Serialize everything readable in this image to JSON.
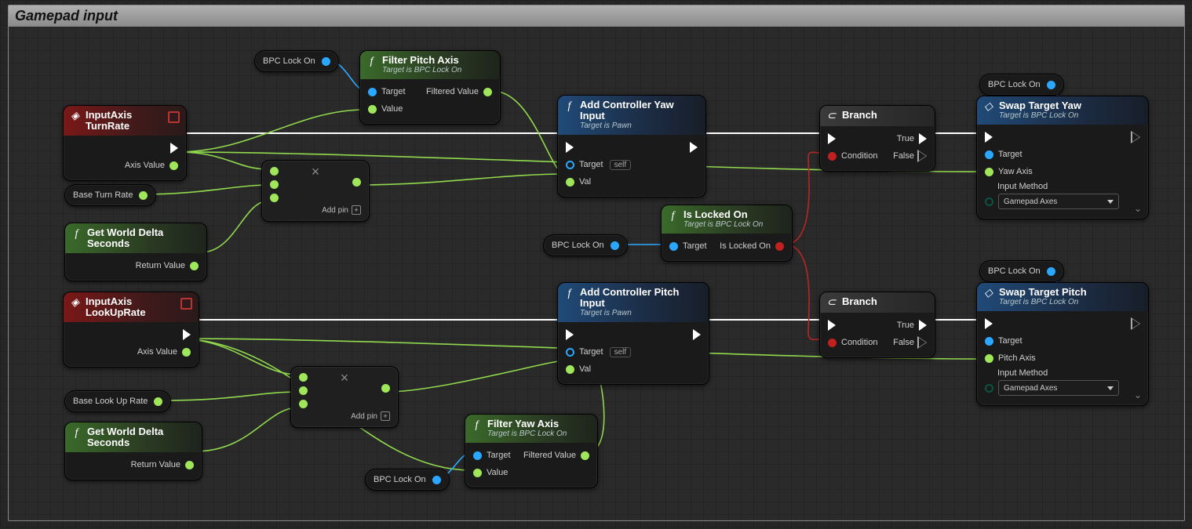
{
  "comment": {
    "title": "Gamepad input"
  },
  "vars": {
    "bpc_lock_on": "BPC Lock On",
    "base_turn_rate": "Base Turn Rate",
    "base_look_up_rate": "Base Look Up Rate"
  },
  "nodes": {
    "turn_rate": {
      "title": "InputAxis TurnRate",
      "axis_value": "Axis Value"
    },
    "lookup_rate": {
      "title": "InputAxis LookUpRate",
      "axis_value": "Axis Value"
    },
    "get_delta": {
      "title": "Get World Delta Seconds",
      "return": "Return Value"
    },
    "mult": {
      "add_pin": "Add pin"
    },
    "filter_pitch": {
      "title": "Filter Pitch Axis",
      "sub": "Target is BPC Lock On",
      "target": "Target",
      "value": "Value",
      "filtered": "Filtered Value"
    },
    "filter_yaw": {
      "title": "Filter Yaw Axis",
      "sub": "Target is BPC Lock On",
      "target": "Target",
      "value": "Value",
      "filtered": "Filtered Value"
    },
    "add_yaw": {
      "title": "Add Controller Yaw Input",
      "sub": "Target is Pawn",
      "target": "Target",
      "self": "self",
      "val": "Val"
    },
    "add_pitch": {
      "title": "Add Controller Pitch Input",
      "sub": "Target is Pawn",
      "target": "Target",
      "self": "self",
      "val": "Val"
    },
    "is_locked": {
      "title": "Is Locked On",
      "sub": "Target is BPC Lock On",
      "target": "Target",
      "out": "Is Locked On"
    },
    "branch": {
      "title": "Branch",
      "cond": "Condition",
      "t": "True",
      "f": "False"
    },
    "swap_yaw": {
      "title": "Swap Target Yaw",
      "sub": "Target is BPC Lock On",
      "target": "Target",
      "axis": "Yaw Axis",
      "method_lbl": "Input Method",
      "method_val": "Gamepad Axes"
    },
    "swap_pitch": {
      "title": "Swap Target Pitch",
      "sub": "Target is BPC Lock On",
      "target": "Target",
      "axis": "Pitch Axis",
      "method_lbl": "Input Method",
      "method_val": "Gamepad Axes"
    }
  }
}
